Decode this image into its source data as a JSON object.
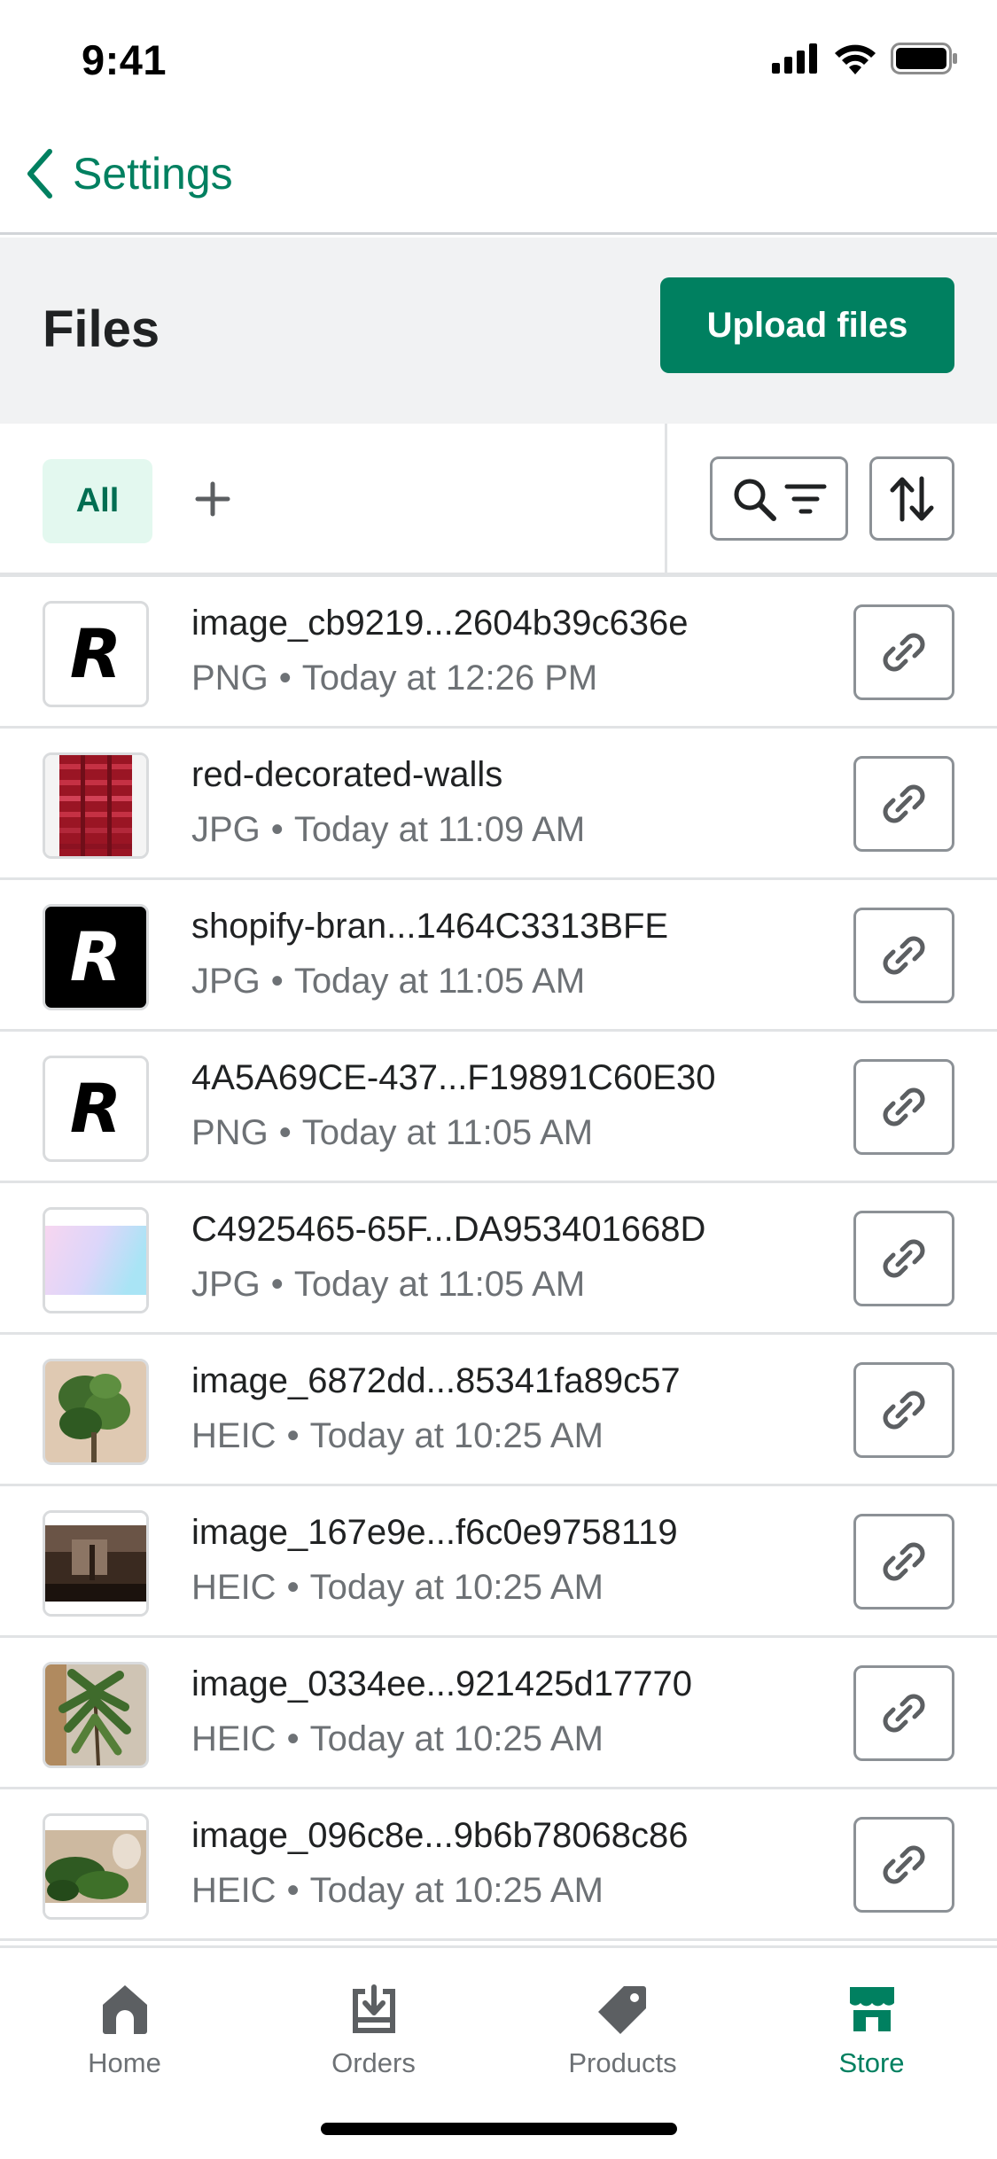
{
  "status_bar": {
    "time": "9:41"
  },
  "nav": {
    "back_label": "Settings"
  },
  "header": {
    "title": "Files",
    "upload_label": "Upload files"
  },
  "tabs": {
    "all_label": "All"
  },
  "files": [
    {
      "name": "image_cb9219...2604b39c636e",
      "type": "PNG",
      "date": "Today at 12:26 PM",
      "thumb": "r-logo-white"
    },
    {
      "name": "red-decorated-walls",
      "type": "JPG",
      "date": "Today at 11:09 AM",
      "thumb": "red-walls-photo"
    },
    {
      "name": "shopify-bran...1464C3313BFE",
      "type": "JPG",
      "date": "Today at 11:05 AM",
      "thumb": "r-logo-black"
    },
    {
      "name": "4A5A69CE-437...F19891C60E30",
      "type": "PNG",
      "date": "Today at 11:05 AM",
      "thumb": "r-logo-white"
    },
    {
      "name": "C4925465-65F...DA953401668D",
      "type": "JPG",
      "date": "Today at 11:05 AM",
      "thumb": "pastel-gradient"
    },
    {
      "name": "image_6872dd...85341fa89c57",
      "type": "HEIC",
      "date": "Today at 10:25 AM",
      "thumb": "plant-photo"
    },
    {
      "name": "image_167e9e...f6c0e9758119",
      "type": "HEIC",
      "date": "Today at 10:25 AM",
      "thumb": "dark-room-photo"
    },
    {
      "name": "image_0334ee...921425d17770",
      "type": "HEIC",
      "date": "Today at 10:25 AM",
      "thumb": "palm-photo"
    },
    {
      "name": "image_096c8e...9b6b78068c86",
      "type": "HEIC",
      "date": "Today at 10:25 AM",
      "thumb": "monstera-photo"
    }
  ],
  "tab_bar": [
    {
      "label": "Home",
      "icon": "home-icon",
      "active": false
    },
    {
      "label": "Orders",
      "icon": "orders-icon",
      "active": false
    },
    {
      "label": "Products",
      "icon": "tag-icon",
      "active": false
    },
    {
      "label": "Store",
      "icon": "store-icon",
      "active": true
    }
  ],
  "colors": {
    "brand": "#008060",
    "tab_selected_bg": "#e3f8ef",
    "header_bg": "#f1f2f3",
    "muted_text": "#6d7175"
  }
}
